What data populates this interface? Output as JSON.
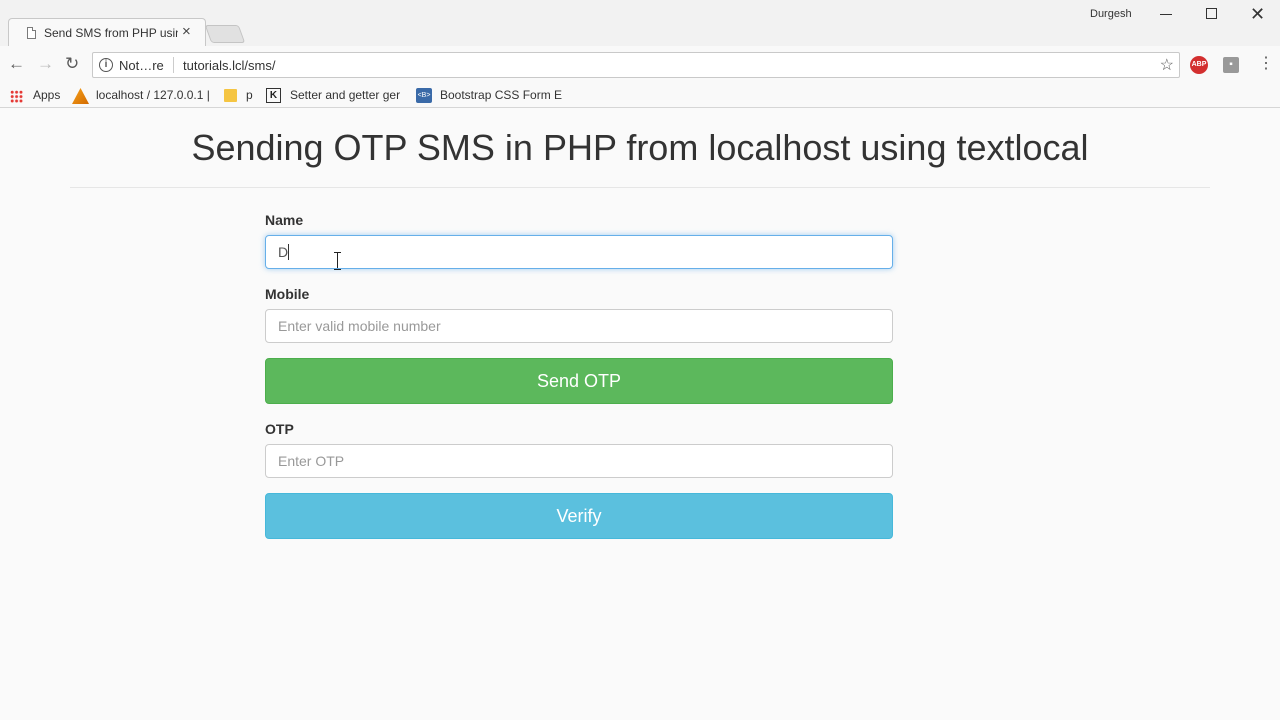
{
  "browser": {
    "tab_title": "Send SMS from PHP using textlocal",
    "tab_close": "×",
    "profile_name": "Durgesh",
    "security_label": "Not…re",
    "url": "tutorials.lcl/sms/",
    "abp_label": "ABP",
    "bookmarks": {
      "apps": "Apps",
      "localhost": "localhost / 127.0.0.1 |",
      "folder_p": "p",
      "setter": "Setter and getter ger",
      "bootstrap": "Bootstrap CSS Form E",
      "bootstrap_icon_text": "<B>",
      "k_icon_text": "K"
    }
  },
  "page": {
    "title": "Sending OTP SMS in PHP from localhost using textlocal",
    "name_label": "Name",
    "name_value": "D",
    "mobile_label": "Mobile",
    "mobile_placeholder": "Enter valid mobile number",
    "send_otp_button": "Send OTP",
    "otp_label": "OTP",
    "otp_placeholder": "Enter OTP",
    "verify_button": "Verify"
  },
  "colors": {
    "send_button": "#5cb85c",
    "verify_button": "#5bc0de",
    "focus_border": "#66afe9"
  }
}
